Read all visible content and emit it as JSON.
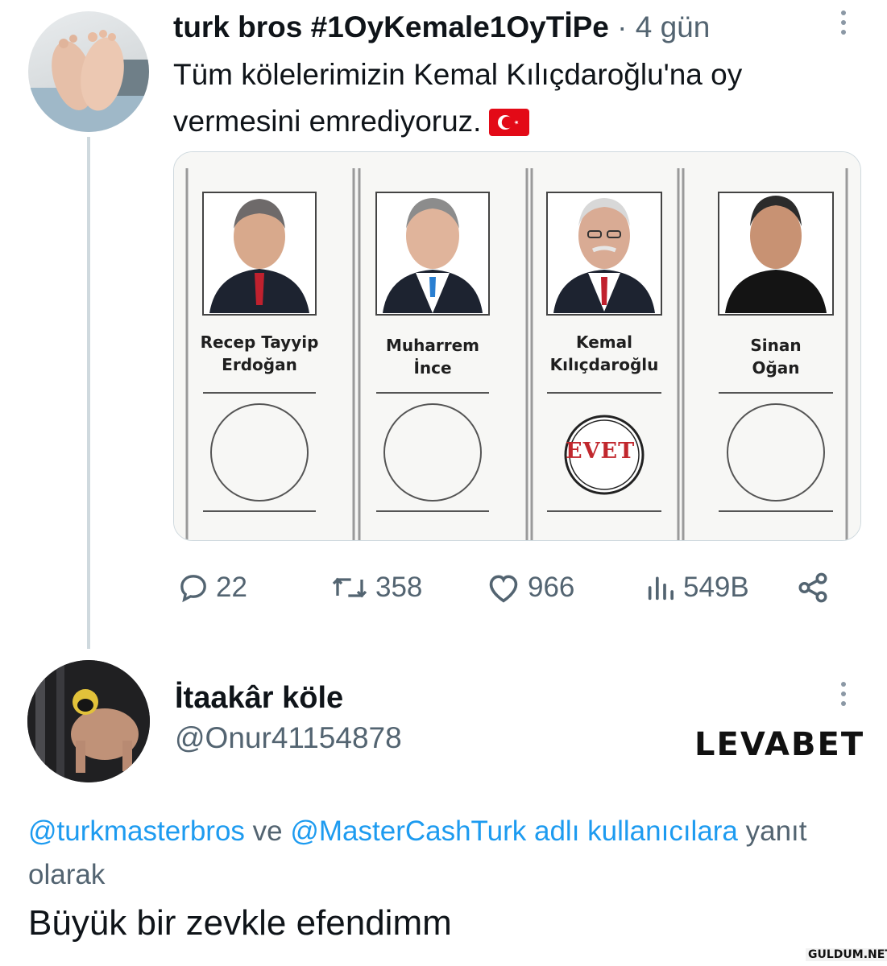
{
  "tweet1": {
    "display_name": "turk bros #1OyKemale1OyTİPe",
    "separator": "·",
    "time": "4 gün",
    "text": "Tüm kölelerimizin Kemal Kılıçdaroğlu'na oy vermesini emrediyoruz.",
    "flag_icon": "turkish-flag-emoji",
    "ballot": {
      "candidates": [
        {
          "name_line1": "Recep Tayyip",
          "name_line2": "Erdoğan",
          "stamped": false
        },
        {
          "name_line1": "Muharrem",
          "name_line2": "İnce",
          "stamped": false
        },
        {
          "name_line1": "Kemal",
          "name_line2": "Kılıçdaroğlu",
          "stamped": true
        },
        {
          "name_line1": "Sinan",
          "name_line2": "Oğan",
          "stamped": false
        }
      ],
      "stamp_text": "EVET"
    },
    "actions": {
      "replies": "22",
      "retweets": "358",
      "likes": "966",
      "views": "549B"
    }
  },
  "tweet2": {
    "display_name": "İtaakâr köle",
    "handle": "@Onur41154878",
    "reply_prefix_mention1": "@turkmasterbros",
    "reply_connector": " ve ",
    "reply_prefix_mention2": "@MasterCashTurk adlı kullanıcılara",
    "reply_suffix": " yanıt olarak",
    "text": "Büyük bir zevkle efendimm"
  },
  "overlay": {
    "brand": "LEVABET",
    "watermark": "GULDUM.NET"
  },
  "colors": {
    "text": "#0f1419",
    "secondary": "#536471",
    "link": "#1d9bf0",
    "stamp": "#c1272d",
    "flag": "#e30a17"
  }
}
